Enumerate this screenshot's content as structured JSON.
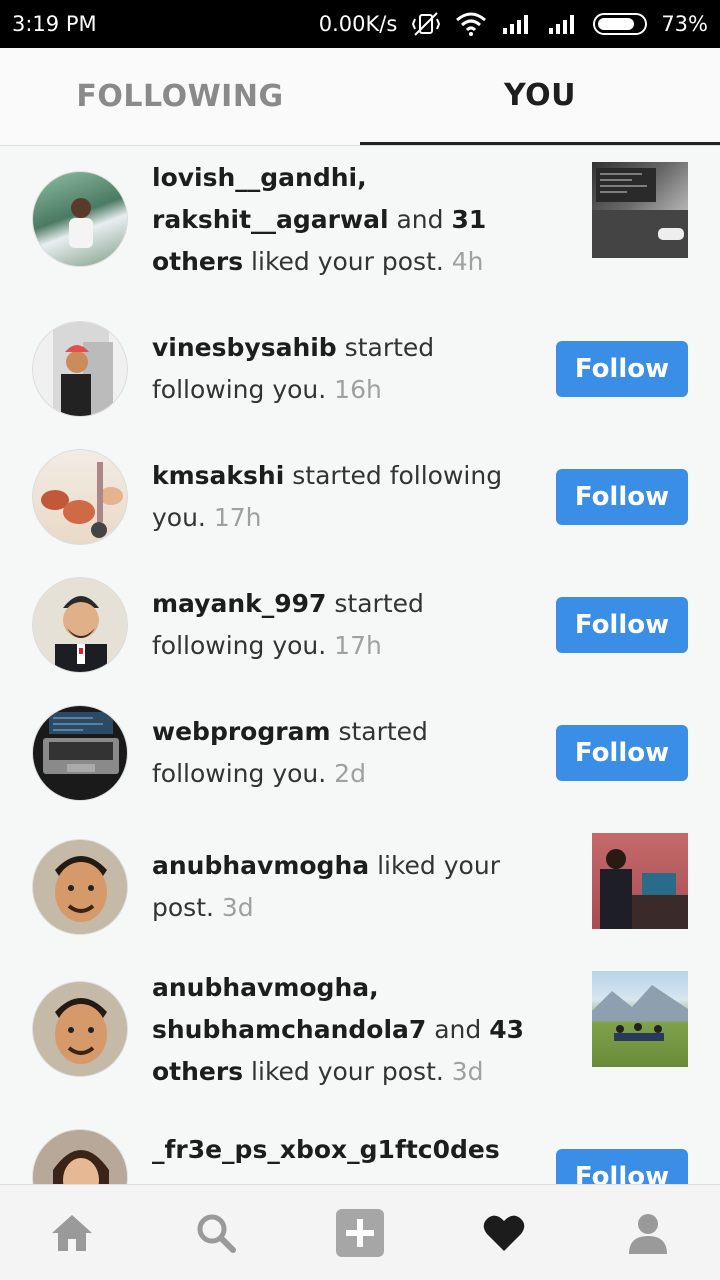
{
  "status_bar": {
    "time": "3:19 PM",
    "net_speed": "0.00K/s",
    "battery": "73%",
    "icons": [
      "vibrate-off-icon",
      "wifi-icon",
      "signal-icon",
      "signal-icon",
      "battery-icon"
    ]
  },
  "tabs": [
    {
      "label": "FOLLOWING",
      "active": false
    },
    {
      "label": "YOU",
      "active": true
    }
  ],
  "activity": [
    {
      "user1": "lovish__gandhi,",
      "user2": "rakshit__agarwal",
      "and": "and",
      "count": "31",
      "others": "others",
      "action": "liked your post.",
      "time": "4h",
      "type": "like"
    },
    {
      "user": "vinesbysahib",
      "action": "started following you.",
      "time": "16h",
      "type": "follow",
      "button": "Follow"
    },
    {
      "user": "kmsakshi",
      "action": "started following you.",
      "time": "17h",
      "type": "follow",
      "button": "Follow"
    },
    {
      "user": "mayank_997",
      "action": "started following you.",
      "time": "17h",
      "type": "follow",
      "button": "Follow"
    },
    {
      "user": "webprogram",
      "action": "started following you.",
      "time": "2d",
      "type": "follow",
      "button": "Follow"
    },
    {
      "user": "anubhavmogha",
      "action": "liked your post.",
      "time": "3d",
      "type": "like"
    },
    {
      "user1": "anubhavmogha,",
      "user2": "shubhamchandola7",
      "and": "and",
      "count": "43",
      "others": "others",
      "action": "liked your post.",
      "time": "3d",
      "type": "like"
    },
    {
      "user": "_fr3e_ps_xbox_g1ftc0des",
      "type": "follow",
      "button": "Follow"
    }
  ],
  "nav": {
    "items": [
      "home-icon",
      "search-icon",
      "add-post-icon",
      "heart-icon",
      "profile-icon"
    ],
    "active": "heart-icon"
  },
  "colors": {
    "accent": "#3a8ee6",
    "status_bar": "#000000",
    "background": "#f6f8f7"
  }
}
